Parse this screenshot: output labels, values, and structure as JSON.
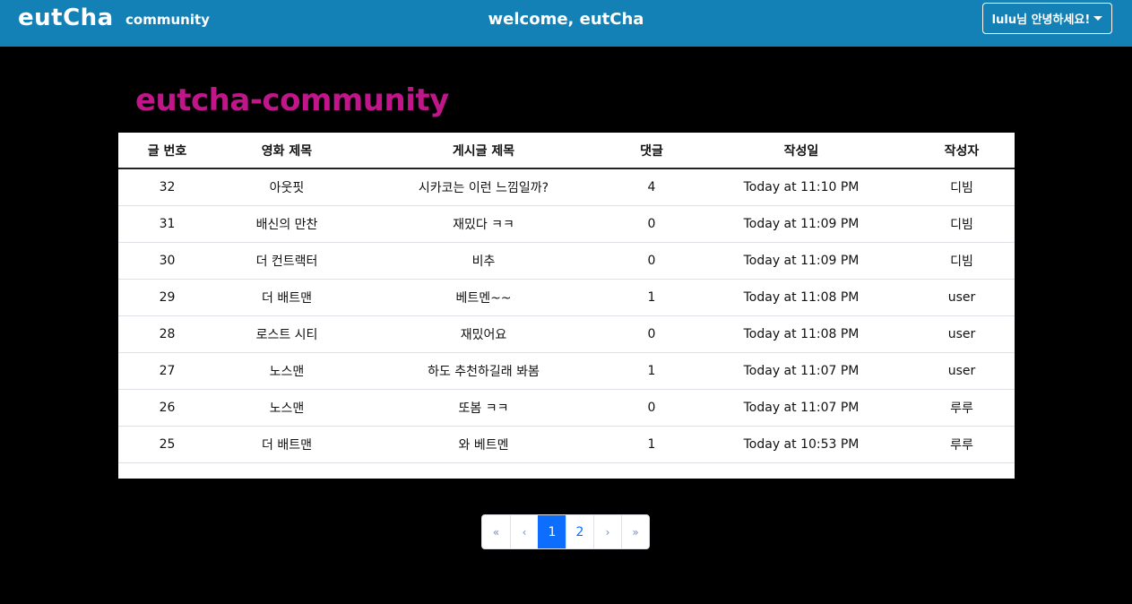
{
  "navbar": {
    "brand": "eutCha",
    "community_link": "community",
    "welcome": "welcome, eutCha",
    "user_menu": "lulu님 안녕하세요!"
  },
  "page_title": "eutcha-community",
  "table": {
    "headers": [
      "글 번호",
      "영화 제목",
      "게시글 제목",
      "댓글",
      "작성일",
      "작성자"
    ],
    "rows": [
      [
        "32",
        "아웃핏",
        "시카코는 이런 느낌일까?",
        "4",
        "Today at 11:10 PM",
        "디빔"
      ],
      [
        "31",
        "배신의 만찬",
        "재밌다 ㅋㅋ",
        "0",
        "Today at 11:09 PM",
        "디빔"
      ],
      [
        "30",
        "더 컨트랙터",
        "비추",
        "0",
        "Today at 11:09 PM",
        "디빔"
      ],
      [
        "29",
        "더 배트맨",
        "베트멘~~",
        "1",
        "Today at 11:08 PM",
        "user"
      ],
      [
        "28",
        "로스트 시티",
        "재밌어요",
        "0",
        "Today at 11:08 PM",
        "user"
      ],
      [
        "27",
        "노스맨",
        "하도 추천하길래 봐봄",
        "1",
        "Today at 11:07 PM",
        "user"
      ],
      [
        "26",
        "노스맨",
        "또봄 ㅋㅋ",
        "0",
        "Today at 11:07 PM",
        "루루"
      ],
      [
        "25",
        "더 배트맨",
        "와 베트멘",
        "1",
        "Today at 10:53 PM",
        "루루"
      ]
    ]
  },
  "pagination": {
    "first": "«",
    "prev": "‹",
    "pages": [
      "1",
      "2"
    ],
    "active": "1",
    "next": "›",
    "last": "»"
  },
  "colors": {
    "navbar": "#1481b6",
    "title": "#c0168a",
    "active_page": "#0d6efd"
  }
}
